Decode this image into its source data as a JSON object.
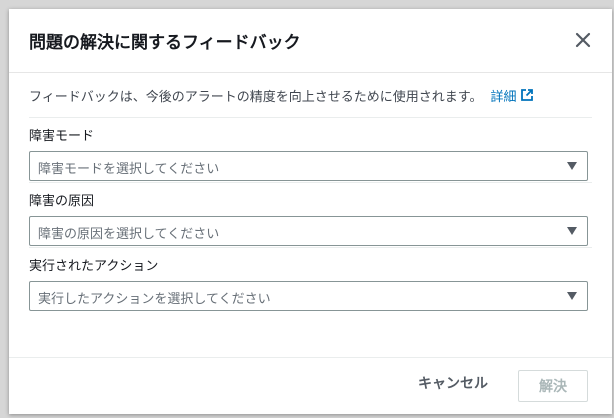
{
  "modal": {
    "title": "問題の解決に関するフィードバック",
    "description": "フィードバックは、今後のアラートの精度を向上させるために使用されます。",
    "details_link": "詳細",
    "close_icon": "close-icon",
    "external_icon": "external-link-icon"
  },
  "fields": [
    {
      "label": "障害モード",
      "placeholder": "障害モードを選択してください"
    },
    {
      "label": "障害の原因",
      "placeholder": "障害の原因を選択してください"
    },
    {
      "label": "実行されたアクション",
      "placeholder": "実行したアクションを選択してください"
    }
  ],
  "footer": {
    "cancel_label": "キャンセル",
    "resolve_label": "解決"
  },
  "colors": {
    "link": "#0073bb",
    "disabled_text": "#aab7b8",
    "title": "#16191f"
  }
}
